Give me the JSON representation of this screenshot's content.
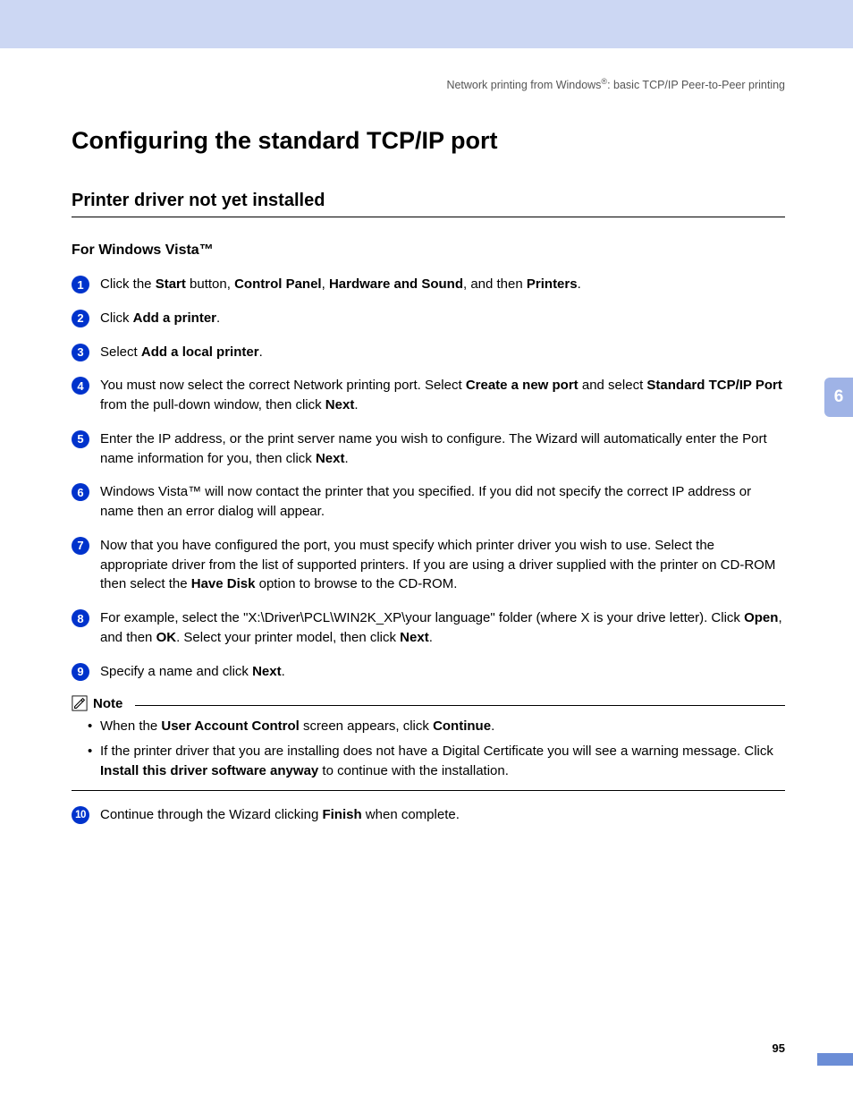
{
  "breadcrumb": {
    "prefix": "Network printing from Windows",
    "sup": "®",
    "suffix": ": basic TCP/IP Peer-to-Peer printing"
  },
  "h1": "Configuring the standard TCP/IP port",
  "h2": "Printer driver not yet installed",
  "h3": "For Windows Vista™",
  "steps": [
    {
      "n": "1",
      "html": "Click the <b>Start</b> button, <b>Control Panel</b>, <b>Hardware and Sound</b>, and then <b>Printers</b>."
    },
    {
      "n": "2",
      "html": "Click <b>Add a printer</b>."
    },
    {
      "n": "3",
      "html": "Select <b>Add a local printer</b>."
    },
    {
      "n": "4",
      "html": "You must now select the correct Network printing port. Select <b>Create a new port</b> and select <b>Standard TCP/IP Port</b> from the pull-down window, then click <b>Next</b>."
    },
    {
      "n": "5",
      "html": "Enter the IP address, or the print server name you wish to configure. The Wizard will automatically enter the Port name information for you, then click <b>Next</b>."
    },
    {
      "n": "6",
      "html": "Windows Vista™ will now contact the printer that you specified. If you did not specify the correct IP address or name then an error dialog will appear."
    },
    {
      "n": "7",
      "html": "Now that you have configured the port, you must specify which printer driver you wish to use. Select the appropriate driver from the list of supported printers. If you are using a driver supplied with the printer on CD-ROM then select the <b>Have Disk</b> option to browse to the CD-ROM."
    },
    {
      "n": "8",
      "html": "For example, select the \"X:\\Driver\\PCL\\WIN2K_XP\\your language\" folder (where X is your drive letter). Click <b>Open</b>, and then <b>OK</b>. Select your printer model, then click <b>Next</b>."
    },
    {
      "n": "9",
      "html": "Specify a name and click <b>Next</b>."
    }
  ],
  "note": {
    "label": "Note",
    "items": [
      "When the <b>User Account Control</b> screen appears, click <b>Continue</b>.",
      "If the printer driver that you are installing does not have a Digital Certificate you will see a warning message. Click <b>Install this driver software anyway</b> to continue with the installation."
    ]
  },
  "step10": {
    "n": "10",
    "html": "Continue through the Wizard clicking <b>Finish</b> when complete."
  },
  "sideTab": "6",
  "pageNum": "95"
}
